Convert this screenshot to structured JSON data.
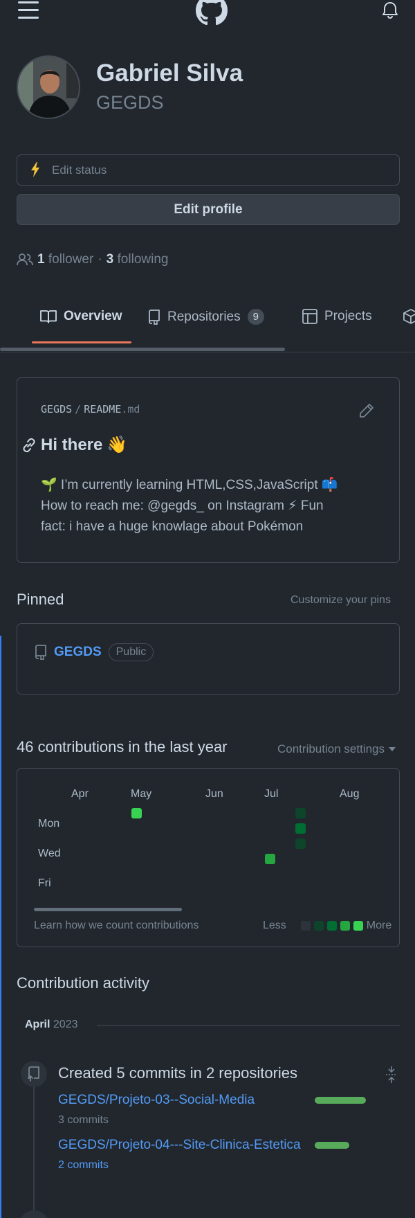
{
  "header": {
    "menu_icon": "hamburger-icon",
    "logo_icon": "github-octocat-icon",
    "notifications_icon": "bell-icon"
  },
  "profile": {
    "name": "Gabriel Silva",
    "login": "GEGDS",
    "status_placeholder": "Edit status",
    "edit_profile_label": "Edit profile",
    "followers_count": "1",
    "followers_label": "follower",
    "separator": "·",
    "following_count": "3",
    "following_label": "following"
  },
  "tabs": [
    {
      "label": "Overview",
      "icon": "book-icon",
      "active": true
    },
    {
      "label": "Repositories",
      "icon": "repo-icon",
      "counter": "9"
    },
    {
      "label": "Projects",
      "icon": "table-icon"
    }
  ],
  "readme": {
    "owner": "GEGDS",
    "slash": "/",
    "file_name": "README",
    "file_ext": ".md",
    "heading": "Hi there",
    "heading_emoji": "👋",
    "lines": [
      "🌱 I’m currently learning HTML,CSS,JavaScript 📫",
      "How to reach me: @gegds_ on Instagram ⚡ Fun",
      "fact: i have a huge knowlage about Pokémon"
    ]
  },
  "pinned": {
    "title": "Pinned",
    "customize_label": "Customize your pins",
    "items": [
      {
        "name": "GEGDS",
        "visibility": "Public"
      }
    ]
  },
  "contributions": {
    "title": "46 contributions in the last year",
    "settings_label": "Contribution settings",
    "months": [
      "Apr",
      "May",
      "Jun",
      "Jul",
      "Aug"
    ],
    "days": [
      "Mon",
      "Wed",
      "Fri"
    ],
    "learn_label": "Learn how we count contributions",
    "legend_less": "Less",
    "legend_more": "More",
    "colors": {
      "level0": "#2d333b",
      "level1": "#0e4429",
      "level2": "#006d32",
      "level3": "#26a641",
      "level4": "#39d353"
    }
  },
  "activity": {
    "title": "Contribution activity",
    "month": "April",
    "year": "2023",
    "event_title": "Created 5 commits in 2 repositories",
    "repos": [
      {
        "name": "GEGDS/Projeto-03--Social-Media",
        "commits": "3 commits",
        "share": 0.6
      },
      {
        "name": "GEGDS/Projeto-04---Site-Clinica-Estetica",
        "commits": "2 commits",
        "share": 0.4
      }
    ]
  }
}
